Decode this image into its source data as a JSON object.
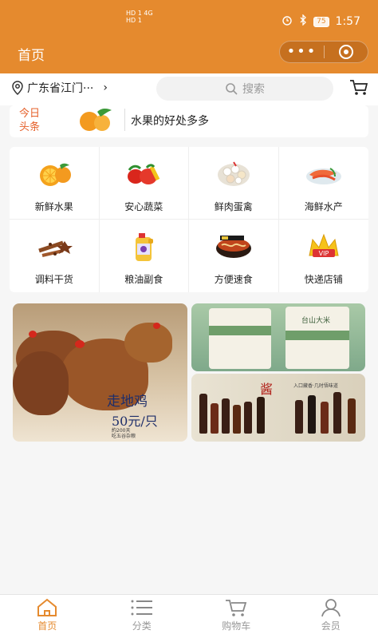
{
  "status_bar": {
    "network_line1": "HD 1  4G",
    "network_line2": "HD 1",
    "battery": "75",
    "time": "1:57",
    "text_color": "#ffffff"
  },
  "header": {
    "title": "首页",
    "more_icon": "more-dots-icon",
    "close_icon": "target-close-icon",
    "brand_color": "#e58a2e"
  },
  "location": {
    "text": "广东省江门···",
    "chevron": "›"
  },
  "search": {
    "placeholder": "搜索"
  },
  "headline": {
    "tag_line1": "今日",
    "tag_line2": "头条",
    "text": "水果的好处多多",
    "accent_color": "#e5602a"
  },
  "categories": [
    {
      "label": "新鲜水果",
      "icon": "orange-icon"
    },
    {
      "label": "安心蔬菜",
      "icon": "vegetables-icon"
    },
    {
      "label": "鲜肉蛋禽",
      "icon": "eggs-icon"
    },
    {
      "label": "海鲜水产",
      "icon": "seafood-icon"
    },
    {
      "label": "调料干货",
      "icon": "spices-icon"
    },
    {
      "label": "粮油副食",
      "icon": "oil-bottle-icon"
    },
    {
      "label": "方便速食",
      "icon": "noodles-icon"
    },
    {
      "label": "快递店铺",
      "icon": "vip-crown-icon"
    }
  ],
  "banners": {
    "chicken": {
      "title": "走地鸡",
      "price": "50元/只",
      "small_line1": "約200天",
      "small_line2": "吃五谷杂粮"
    },
    "rice": {
      "bag1": "",
      "bag2": "台山大米"
    },
    "sauce": {
      "title": "酱",
      "subtitle": "入口藏香·几时悟味道"
    }
  },
  "tabbar": {
    "items": [
      {
        "label": "首页",
        "icon": "home-icon",
        "active": true
      },
      {
        "label": "分类",
        "icon": "list-icon",
        "active": false
      },
      {
        "label": "购物车",
        "icon": "cart-icon",
        "active": false
      },
      {
        "label": "会员",
        "icon": "user-icon",
        "active": false
      }
    ],
    "active_color": "#e58a2e",
    "inactive_color": "#999999"
  }
}
